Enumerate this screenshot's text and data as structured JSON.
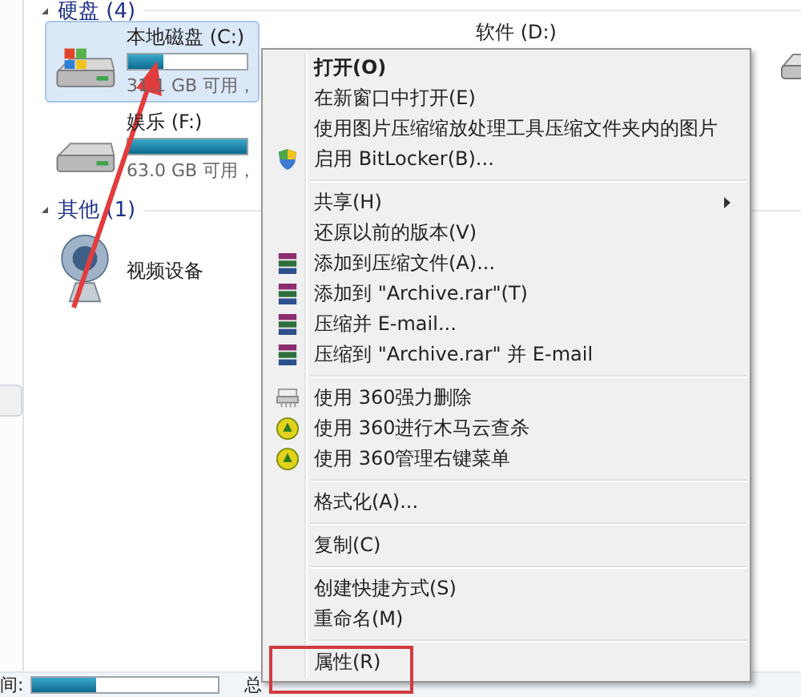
{
  "sections": [
    {
      "title": "硬盘 (4)",
      "tiles": [
        {
          "name": "本地磁盘 (C:)",
          "free": "31.1 GB 可用，",
          "level": 0.3,
          "selected": true,
          "kind": "system-drive"
        },
        {
          "name": "娱乐 (F:)",
          "free": "63.0 GB 可用，",
          "level": 1,
          "selected": false,
          "kind": "drive"
        }
      ]
    },
    {
      "title": "其他 (1)",
      "tiles": [
        {
          "name": "视频设备",
          "selected": false,
          "kind": "camera"
        }
      ]
    }
  ],
  "side_drive": {
    "name": "软件 (D:)"
  },
  "context_menu": [
    {
      "kind": "plain",
      "label": "打开(O)",
      "default": true
    },
    {
      "kind": "plain",
      "label": "在新窗口中打开(E)",
      "default": false
    },
    {
      "kind": "plain",
      "label": "使用图片压缩缩放处理工具压缩文件夹内的图片",
      "default": false
    },
    {
      "kind": "shield",
      "label": "启用 BitLocker(B)...",
      "default": false
    },
    {
      "kind": "separator"
    },
    {
      "kind": "plain",
      "label": "共享(H)",
      "default": false,
      "submenu": true
    },
    {
      "kind": "plain",
      "label": "还原以前的版本(V)",
      "default": false
    },
    {
      "kind": "archive",
      "label": "添加到压缩文件(A)...",
      "default": false
    },
    {
      "kind": "archive",
      "label": "添加到 \"Archive.rar\"(T)",
      "default": false
    },
    {
      "kind": "archive",
      "label": "压缩并 E-mail...",
      "default": false
    },
    {
      "kind": "archive",
      "label": "压缩到 \"Archive.rar\" 并 E-mail",
      "default": false
    },
    {
      "kind": "separator"
    },
    {
      "kind": "shredder",
      "label": "使用 360强力删除",
      "default": false
    },
    {
      "kind": "guard",
      "label": "使用 360进行木马云查杀",
      "default": false
    },
    {
      "kind": "guard",
      "label": "使用 360管理右键菜单",
      "default": false
    },
    {
      "kind": "separator"
    },
    {
      "kind": "plain",
      "label": "格式化(A)...",
      "default": false
    },
    {
      "kind": "separator"
    },
    {
      "kind": "plain",
      "label": "复制(C)",
      "default": false
    },
    {
      "kind": "separator"
    },
    {
      "kind": "plain",
      "label": "创建快捷方式(S)",
      "default": false
    },
    {
      "kind": "plain",
      "label": "重命名(M)",
      "default": false
    },
    {
      "kind": "separator"
    },
    {
      "kind": "plain",
      "label": "属性(R)",
      "default": false
    }
  ],
  "status_bar": {
    "used_label": "间:",
    "level": 0.35,
    "total_label": "总"
  }
}
